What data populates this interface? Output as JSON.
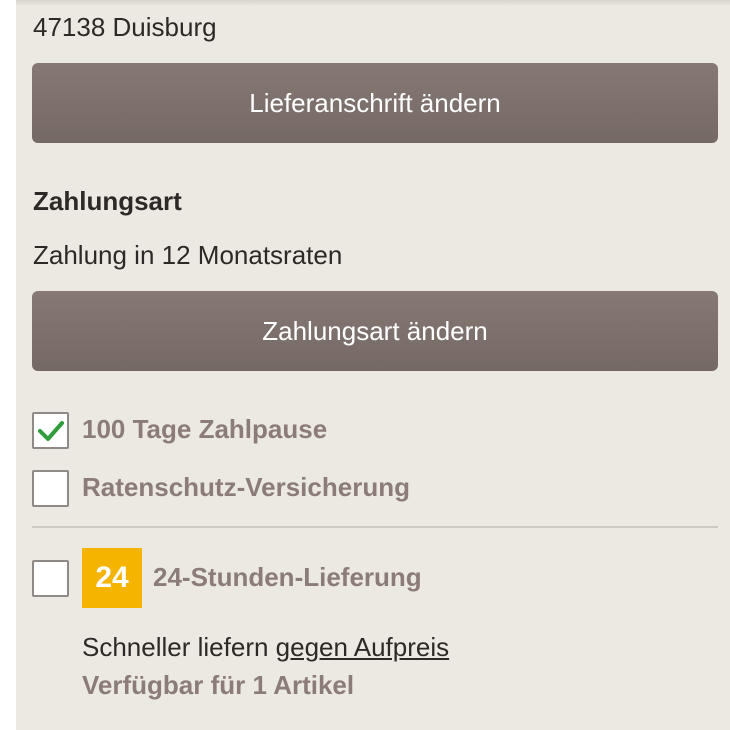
{
  "address": {
    "city_line": "47138 Duisburg"
  },
  "buttons": {
    "change_address": "Lieferanschrift ändern",
    "change_payment": "Zahlungsart ändern"
  },
  "payment": {
    "heading": "Zahlungsart",
    "method": "Zahlung in 12 Monatsraten"
  },
  "options": [
    {
      "label": "100 Tage Zahlpause",
      "checked": true
    },
    {
      "label": "Ratenschutz-Versicherung",
      "checked": false
    }
  ],
  "delivery": {
    "badge": "24",
    "label": "24-Stunden-Lieferung",
    "checked": false,
    "desc_prefix": "Schneller liefern ",
    "desc_link": "gegen Aufpreis",
    "availability": "Verfügbar für 1 Artikel"
  },
  "colors": {
    "button": "#7c706b",
    "badge": "#f4b400",
    "check": "#2e9d3a",
    "panel": "#ece9e3"
  },
  "icons": {
    "checked": "checkmark-icon"
  }
}
